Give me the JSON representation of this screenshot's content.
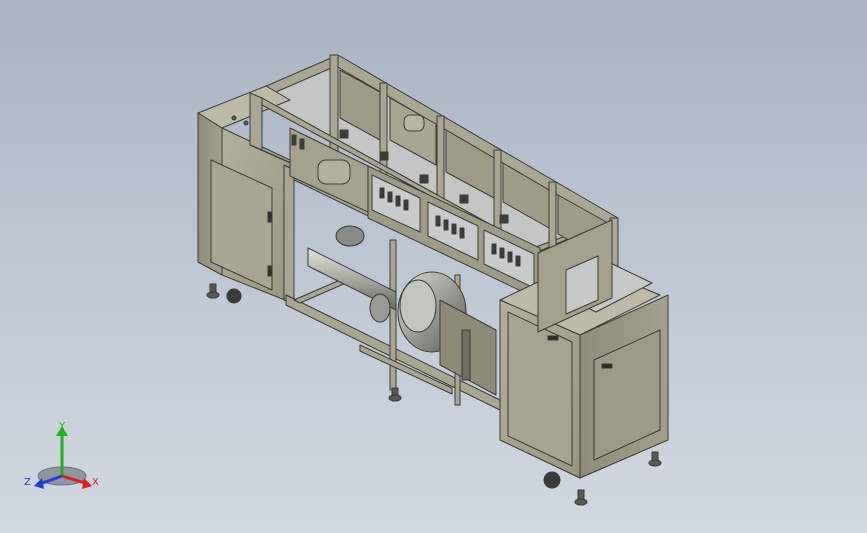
{
  "viewport": {
    "background_top": "#a9b3c2",
    "background_bottom": "#d2d8e1",
    "model_color": "#a6a491",
    "edge_color": "#3a3a35"
  },
  "triad": {
    "x_label": "X",
    "y_label": "Y",
    "z_label": "Z",
    "x_color": "#d82020",
    "y_color": "#20b020",
    "z_color": "#2040d0"
  }
}
